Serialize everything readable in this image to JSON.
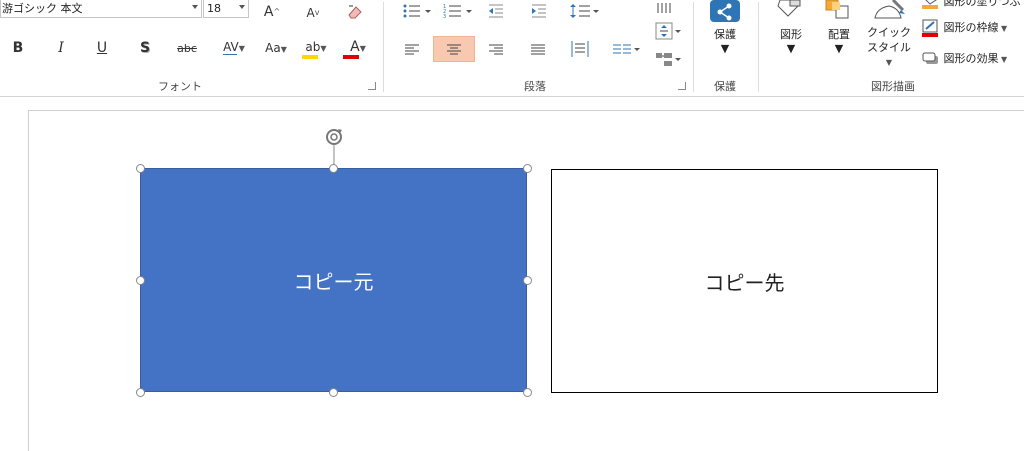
{
  "ribbon": {
    "font_group": {
      "font_name": "游ゴシック 本文",
      "font_size": "18",
      "label": "フォント",
      "bold": "B",
      "italic": "I",
      "underline": "U",
      "shadow": "S",
      "strike": "abc",
      "spacing": "AV",
      "case": "Aa",
      "grow": "A",
      "shrink": "A",
      "font_color": "A",
      "highlight_text": "ab"
    },
    "paragraph_group": {
      "label": "段落"
    },
    "protect_group": {
      "label": "保護",
      "button_label": "保護"
    },
    "drawing_group": {
      "label": "図形描画",
      "shapes_label": "図形",
      "arrange_label": "配置",
      "quick_style_label_1": "クイック",
      "quick_style_label_2": "スタイル",
      "fill_label": "図形の塗りつぶし",
      "outline_label": "図形の枠線",
      "effects_label": "図形の効果"
    }
  },
  "slide": {
    "shape_source_text": "コピー元",
    "shape_dest_text": "コピー先"
  },
  "colors": {
    "shape_fill": "#4472c4",
    "active_align": "#f8c9b0",
    "font_color_bar": "#e00000",
    "highlight_bar": "#ffd700",
    "protect_icon": "#2e75b6"
  }
}
